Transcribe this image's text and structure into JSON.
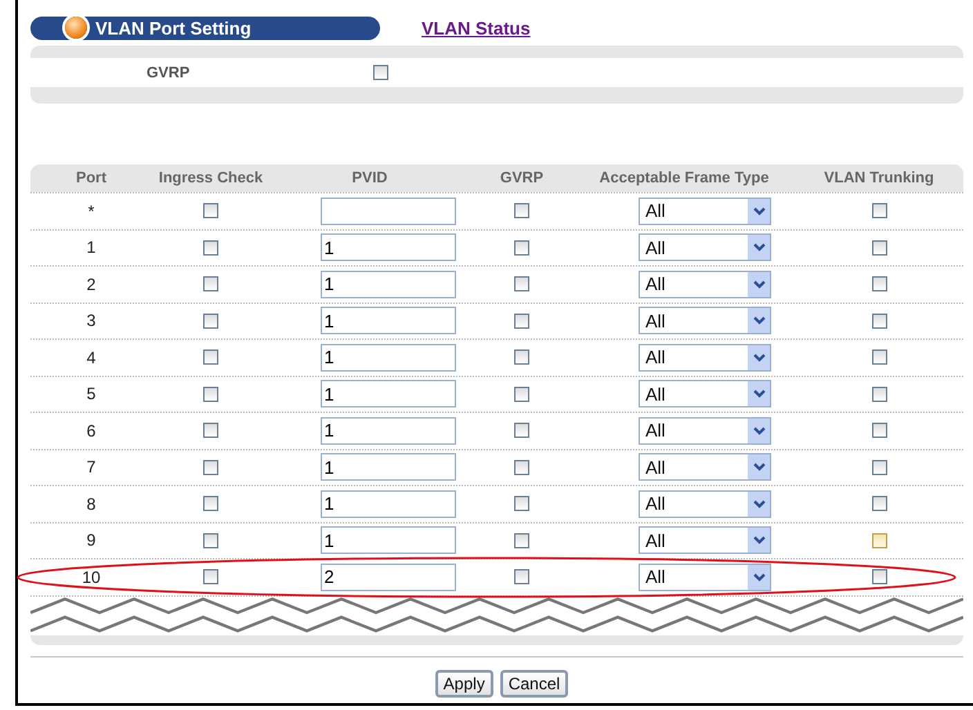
{
  "header": {
    "title": "VLAN Port Setting",
    "link": "VLAN Status"
  },
  "global": {
    "label": "GVRP",
    "checked": false
  },
  "table": {
    "columns": [
      "Port",
      "Ingress Check",
      "PVID",
      "GVRP",
      "Acceptable Frame Type",
      "VLAN Trunking"
    ],
    "rows": [
      {
        "port": "*",
        "ingress_check": false,
        "gvrp": false,
        "frame_type": "All",
        "trunking": false,
        "trunking_highlighted": false
      },
      {
        "port": "1",
        "ingress_check": false,
        "pvid": "1",
        "gvrp": false,
        "frame_type": "All",
        "trunking": false,
        "trunking_highlighted": false
      },
      {
        "port": "2",
        "ingress_check": false,
        "pvid": "1",
        "gvrp": false,
        "frame_type": "All",
        "trunking": false,
        "trunking_highlighted": false
      },
      {
        "port": "3",
        "ingress_check": false,
        "pvid": "1",
        "gvrp": false,
        "frame_type": "All",
        "trunking": false,
        "trunking_highlighted": false
      },
      {
        "port": "4",
        "ingress_check": false,
        "pvid": "1",
        "gvrp": false,
        "frame_type": "All",
        "trunking": false,
        "trunking_highlighted": false
      },
      {
        "port": "5",
        "ingress_check": false,
        "pvid": "1",
        "gvrp": false,
        "frame_type": "All",
        "trunking": false,
        "trunking_highlighted": false
      },
      {
        "port": "6",
        "ingress_check": false,
        "pvid": "1",
        "gvrp": false,
        "frame_type": "All",
        "trunking": false,
        "trunking_highlighted": false
      },
      {
        "port": "7",
        "ingress_check": false,
        "pvid": "1",
        "gvrp": false,
        "frame_type": "All",
        "trunking": false,
        "trunking_highlighted": false
      },
      {
        "port": "8",
        "ingress_check": false,
        "pvid": "1",
        "gvrp": false,
        "frame_type": "All",
        "trunking": false,
        "trunking_highlighted": false
      },
      {
        "port": "9",
        "ingress_check": false,
        "pvid": "1",
        "gvrp": false,
        "frame_type": "All",
        "trunking": false,
        "trunking_highlighted": true
      },
      {
        "port": "10",
        "ingress_check": false,
        "pvid": "2",
        "gvrp": false,
        "frame_type": "All",
        "trunking": false,
        "trunking_highlighted": false
      }
    ]
  },
  "buttons": [
    "Apply",
    "Cancel"
  ]
}
